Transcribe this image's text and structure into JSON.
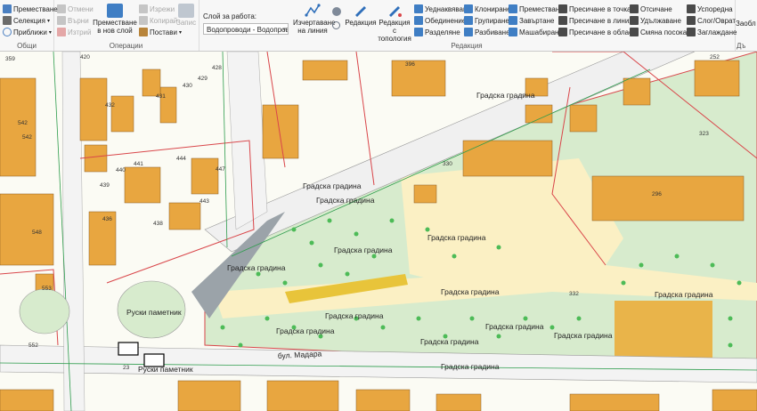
{
  "ribbon": {
    "general": {
      "label": "Общи",
      "move": "Преместване",
      "selection": "Селекция",
      "zoom": "Приближи"
    },
    "operations": {
      "label": "Операции",
      "undo": "Отмени",
      "redo": "Върни",
      "delete": "Изтрий",
      "cut": "Изрежи",
      "copy": "Копирай",
      "paste": "Постави",
      "move_to_layer": "Преместване в нов слой",
      "save": "Запис"
    },
    "editing": {
      "label": "Редакция",
      "working_layer_label": "Слой за работа:",
      "working_layer_value": "Водопроводи - Водопровод",
      "draw_line": "Изчертаване на линия",
      "edit": "Редакция",
      "edit_topology": "Редакция с топология",
      "simplify": "Уеднаквяване",
      "merge": "Обединение",
      "split": "Разделяне",
      "clone": "Клониране",
      "group": "Групиране",
      "explode": "Разбиване",
      "move": "Преместване",
      "rotate": "Завъртане",
      "scale": "Машабиране",
      "intersect_point": "Пресичане в точка",
      "intersect_line": "Пресичане в линия",
      "intersect_area": "Пресичане в област",
      "trim": "Отсичане",
      "extend": "Удължаване",
      "change_direction": "Смяна посоката",
      "parallel": "Успоредна",
      "slope": "Слог/Оврат",
      "smooth": "Заглаждане",
      "extra": "Заобл"
    },
    "tail_label": "Дъ"
  },
  "map": {
    "park_label": "Градска градина",
    "monument_label": "Руски паметник",
    "street_label": "бул. Мадара",
    "building_numbers": [
      "420",
      "396",
      "252",
      "432",
      "431",
      "430",
      "429",
      "428",
      "542",
      "542",
      "441",
      "440",
      "439",
      "447",
      "444",
      "443",
      "438",
      "436",
      "548",
      "553",
      "330",
      "296",
      "332",
      "323",
      "23",
      "552",
      "359"
    ]
  },
  "colors": {
    "building": "#e8a640",
    "building_dark": "#8a5a20",
    "parcel_line": "#d9464a",
    "park": "#d7ebcd",
    "plaza": "#fbf0c4",
    "tree": "#4dbb57",
    "street": "#f3f3f3",
    "pipe": "#2d9c4c"
  }
}
